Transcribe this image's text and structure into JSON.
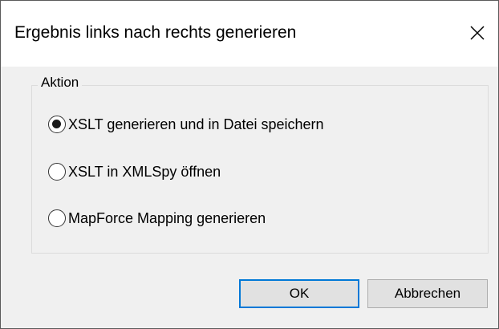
{
  "window": {
    "title": "Ergebnis links nach rechts generieren",
    "close_icon": "close-icon"
  },
  "group": {
    "label": "Aktion",
    "options": [
      {
        "label": "XSLT generieren und in Datei speichern",
        "selected": true
      },
      {
        "label": "XSLT in XMLSpy öffnen",
        "selected": false
      },
      {
        "label": "MapForce Mapping generieren",
        "selected": false
      }
    ]
  },
  "buttons": {
    "ok_label": "OK",
    "cancel_label": "Abbrechen"
  },
  "colors": {
    "default_button_border": "#0078d7",
    "dialog_background": "#f0f0f0",
    "title_background": "#ffffff"
  }
}
